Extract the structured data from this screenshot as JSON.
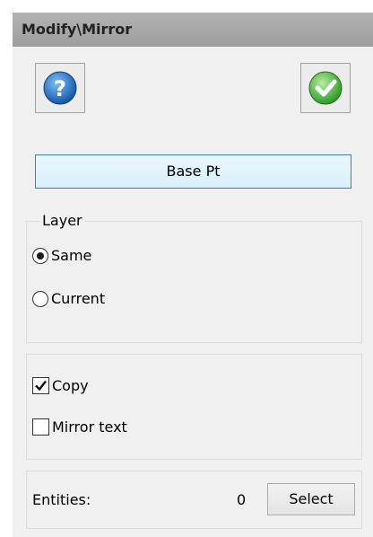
{
  "window": {
    "title": "Modify\\Mirror"
  },
  "toolbar": {
    "help_icon": "help-question-icon",
    "ok_icon": "ok-checkmark-icon"
  },
  "base_point": {
    "label": "Base Pt"
  },
  "layer": {
    "legend": "Layer",
    "options": [
      {
        "label": "Same",
        "selected": true
      },
      {
        "label": "Current",
        "selected": false
      }
    ]
  },
  "options": {
    "copy": {
      "label": "Copy",
      "checked": true
    },
    "mirror_text": {
      "label": "Mirror text",
      "checked": false
    }
  },
  "entities": {
    "label": "Entities:",
    "count": "0",
    "select_label": "Select"
  },
  "colors": {
    "help_blue": "#1f6fc4",
    "ok_green": "#3fae3a",
    "focus_border": "#3c7fb1"
  }
}
